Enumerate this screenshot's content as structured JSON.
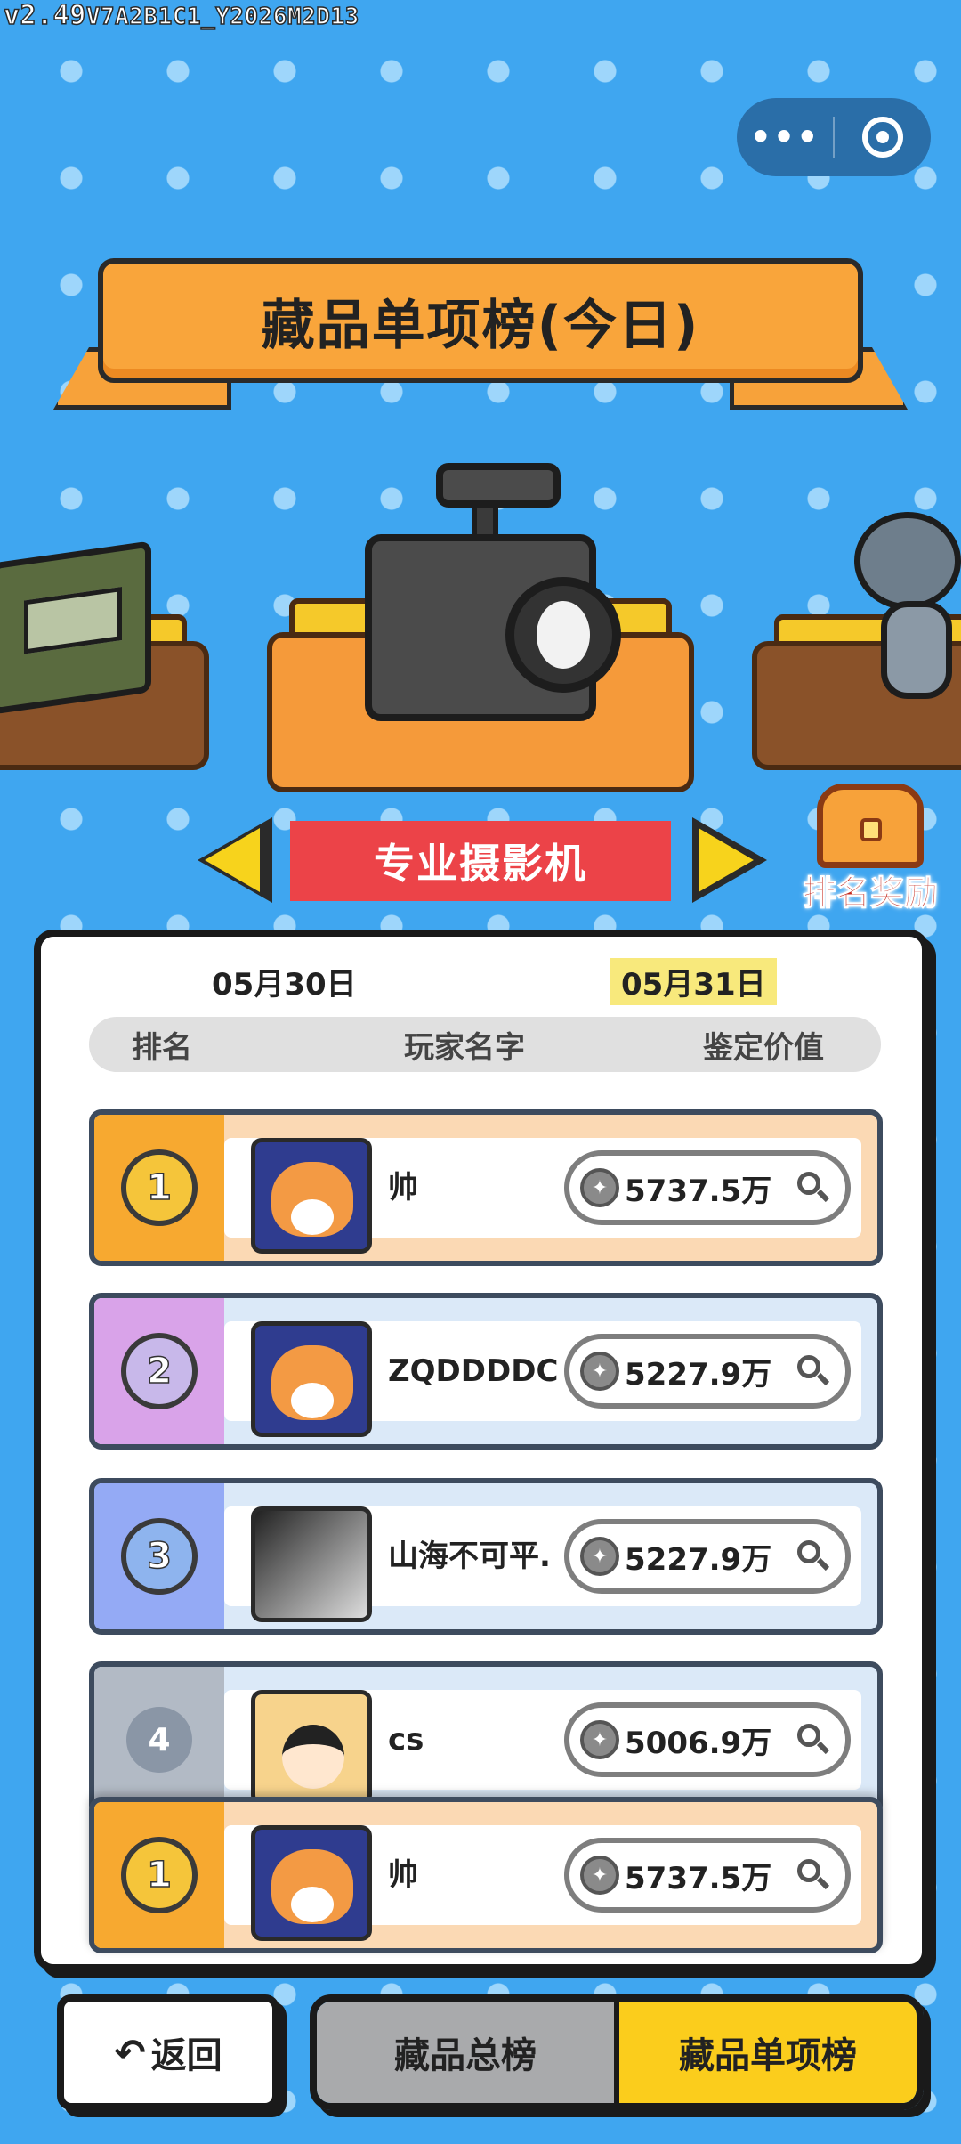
{
  "version": {
    "main": "v2.49",
    "sub": "V7A2B1C1_Y2026M2D13"
  },
  "capsule": {
    "more_label": "•••",
    "more_icon": "more-dots-icon",
    "target_icon": "target-icon"
  },
  "banner": {
    "title": "藏品单项榜(今日)"
  },
  "item": {
    "name": "专业摄影机"
  },
  "reward": {
    "label": "排名奖励",
    "icon": "treasure-chest-icon"
  },
  "dates": {
    "prev": "05月30日",
    "current": "05月31日"
  },
  "table_header": {
    "rank": "排名",
    "player": "玩家名字",
    "value": "鉴定价值"
  },
  "rows": [
    {
      "rank": "1",
      "name": "帅",
      "value": "5737.5万",
      "avatar": "shiba-dog"
    },
    {
      "rank": "2",
      "name": "ZQDDDDC",
      "value": "5227.9万",
      "avatar": "shiba-dog"
    },
    {
      "rank": "3",
      "name": "山海不可平.",
      "value": "5227.9万",
      "avatar": "bw-photo"
    },
    {
      "rank": "4",
      "name": "cs",
      "value": "5006.9万",
      "avatar": "cartoon-boy"
    }
  ],
  "my_row": {
    "rank": "1",
    "name": "帅",
    "value": "5737.5万",
    "avatar": "shiba-dog"
  },
  "footer": {
    "back_label": "返回",
    "tab_total": "藏品总榜",
    "tab_single": "藏品单项榜"
  },
  "colors": {
    "background": "#3fa6f0",
    "accent_red": "#ec4348",
    "accent_yellow": "#fbcd1c",
    "gold": "#f7a930"
  }
}
